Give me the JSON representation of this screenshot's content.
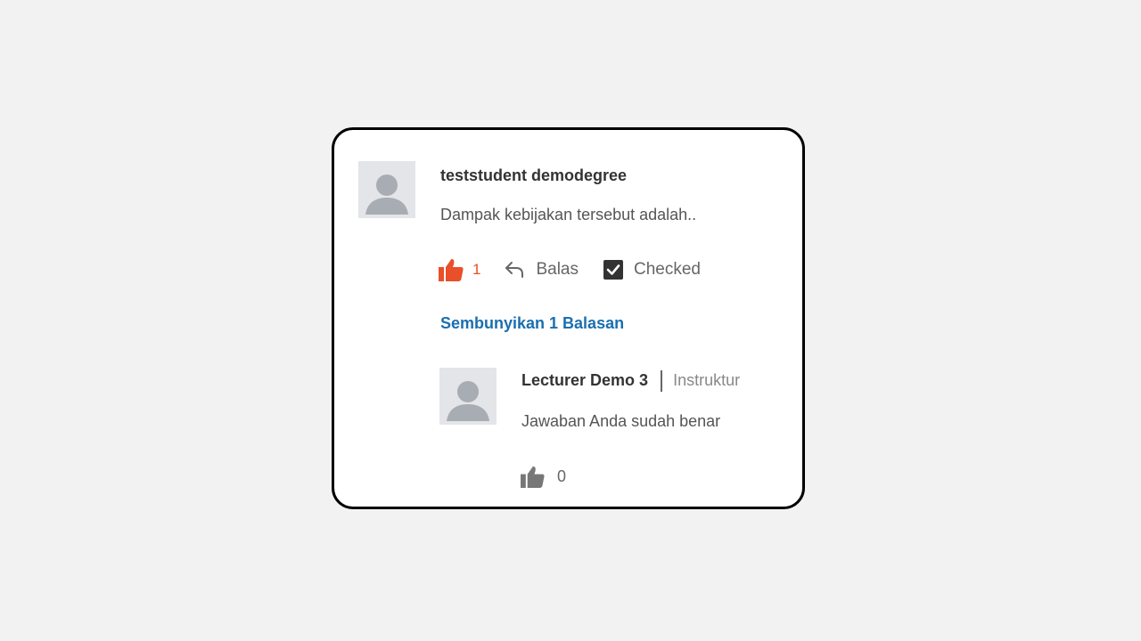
{
  "comment": {
    "author": "teststudent demodegree",
    "text": "Dampak kebijakan tersebut adalah..",
    "like_count": "1",
    "reply_label": "Balas",
    "checked_label": "Checked",
    "toggle_replies_label": "Sembunyikan 1 Balasan",
    "accent_color": "#e94f29",
    "link_color": "#1a6fb0"
  },
  "reply": {
    "author": "Lecturer Demo 3",
    "role": "Instruktur",
    "text": "Jawaban Anda sudah benar",
    "like_count": "0"
  },
  "icons": {
    "avatar": "user-silhouette-icon",
    "like_active": "thumbs-up-filled-icon",
    "reply": "reply-arrow-icon",
    "checked": "checkbox-checked-icon",
    "like_inactive": "thumbs-up-gray-icon"
  }
}
